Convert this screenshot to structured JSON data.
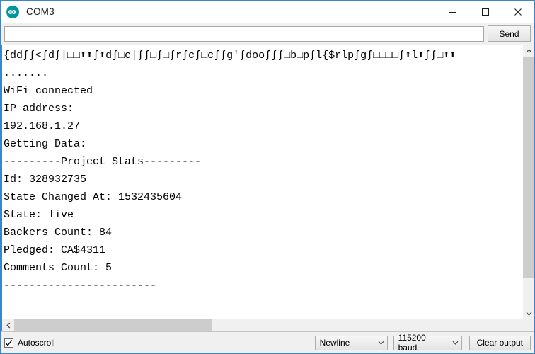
{
  "window": {
    "title": "COM3",
    "logo_icon": "arduino-logo-icon",
    "accent_color": "#3a87c8",
    "controls": [
      {
        "name": "minimize-button",
        "icon": "minimize-icon"
      },
      {
        "name": "maximize-button",
        "icon": "maximize-icon"
      },
      {
        "name": "close-button",
        "icon": "close-icon"
      }
    ]
  },
  "send_bar": {
    "input_value": "",
    "input_placeholder": "",
    "send_label": "Send"
  },
  "console": {
    "lines": [
      "{ddʃʃ<ʃdʃ|□□⬆⬆ʃ⬆dʃ□c|ʃʃ□ʃ□ʃrʃcʃ□cʃʃg'ʃdooʃʃʃ□b□pʃl{$rlpʃgʃ□□□□ʃ⬆l⬆ʃʃ□⬆⬆",
      ".......",
      "WiFi connected",
      "IP address: ",
      "192.168.1.27",
      "Getting Data:",
      "---------Project Stats---------",
      "Id: 328932735",
      "State Changed At: 1532435604",
      "State: live",
      "Backers Count: 84",
      "Pledged: CA$4311",
      "Comments Count: 5",
      "------------------------"
    ]
  },
  "scrollbars": {
    "vertical": {
      "up_icon": "chevron-up-icon",
      "down_icon": "chevron-down-icon",
      "thumb_size_pct": "88%"
    },
    "horizontal": {
      "left_icon": "chevron-left-icon",
      "thumb_size_pct": "39%"
    }
  },
  "status_bar": {
    "autoscroll_label": "Autoscroll",
    "autoscroll_checked": true,
    "line_ending": "Newline",
    "baud_rate": "115200 baud",
    "clear_output_label": "Clear output"
  }
}
